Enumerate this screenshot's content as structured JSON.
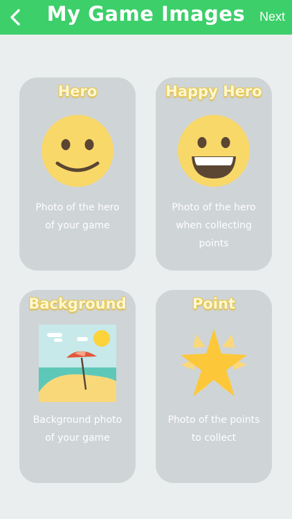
{
  "header": {
    "title": "My Game Images",
    "back_icon": "chevron-left-icon",
    "next_label": "Next"
  },
  "colors": {
    "navbar": "#3ccf6a",
    "background": "#eaeeee",
    "card": "#cfd4d6",
    "title_text": "#fff7d2",
    "emoji_yellow": "#f9d86a",
    "star_yellow": "#fcc83a"
  },
  "cards": [
    {
      "title": "Hero",
      "icon": "smiling-face-icon",
      "description": [
        "Photo of the hero",
        "of your game"
      ]
    },
    {
      "title": "Happy Hero",
      "icon": "grinning-face-icon",
      "description": [
        "Photo of the hero",
        "when collecting",
        "points"
      ]
    },
    {
      "title": "Background",
      "icon": "beach-umbrella-icon",
      "description": [
        "Background photo",
        "of your game"
      ]
    },
    {
      "title": "Point",
      "icon": "star-icon",
      "description": [
        "Photo of the points",
        "to collect"
      ]
    }
  ]
}
